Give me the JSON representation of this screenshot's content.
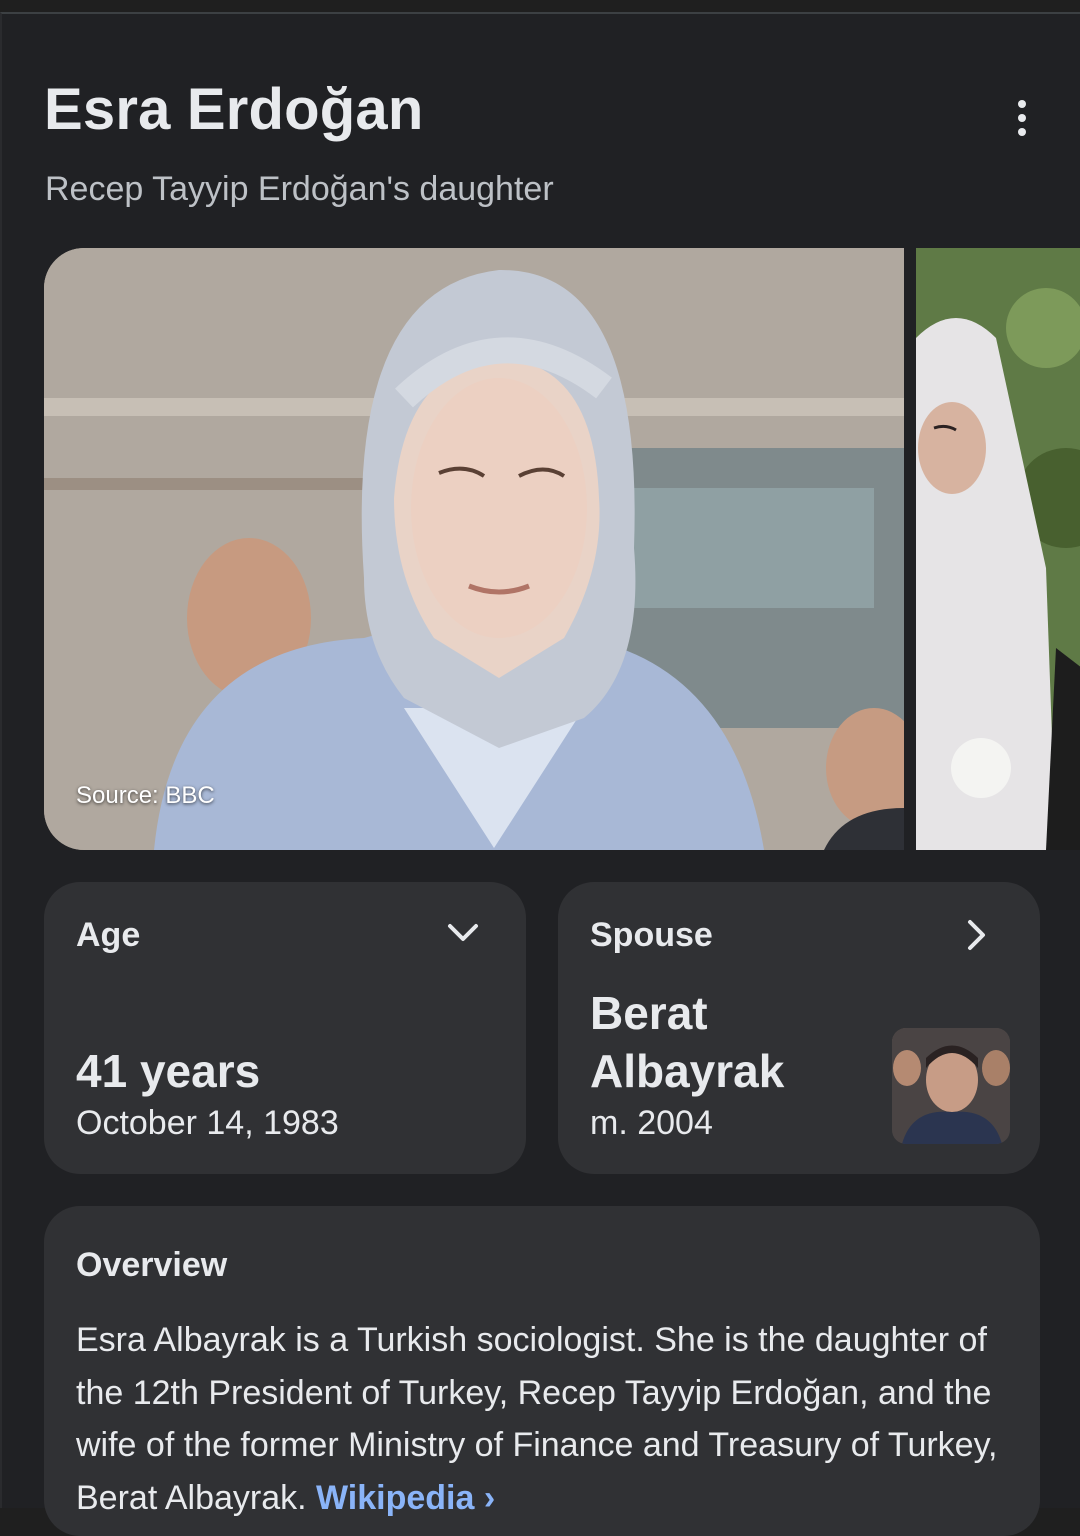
{
  "header": {
    "title": "Esra Erdoğan",
    "subtitle": "Recep Tayyip Erdoğan's daughter"
  },
  "gallery": {
    "source_label": "Source: BBC"
  },
  "age_card": {
    "label": "Age",
    "value": "41 years",
    "date": "October 14, 1983"
  },
  "spouse_card": {
    "label": "Spouse",
    "name": "Berat Albayrak",
    "since": "m. 2004"
  },
  "overview": {
    "label": "Overview",
    "text": "Esra Albayrak is a Turkish sociologist. She is the daughter of the 12th President of Turkey, Recep Tayyip Erdoğan, and the wife of the former Ministry of Finance and Treasury of Turkey, Berat Albayrak. ",
    "link_label": "Wikipedia ›"
  },
  "colors": {
    "background": "#202124",
    "card": "#303134",
    "link": "#8ab4f8"
  }
}
